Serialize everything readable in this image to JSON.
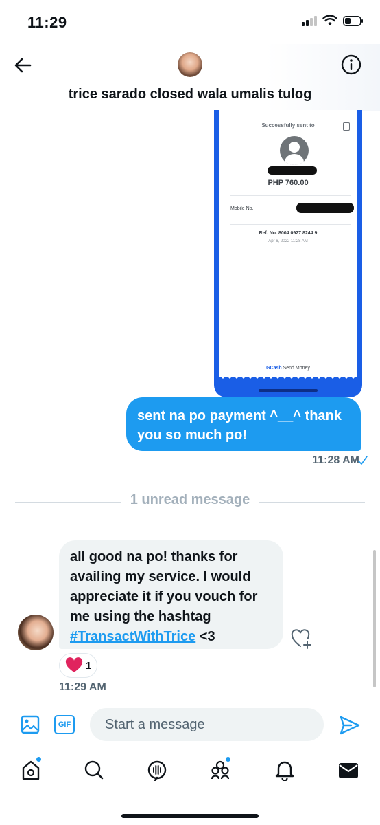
{
  "status_bar": {
    "time": "11:29"
  },
  "header": {
    "title": "trice sarado closed wala umalis tulog"
  },
  "receipt": {
    "heading": "Successfully sent to",
    "amount": "PHP 760.00",
    "mobile_label": "Mobile No.",
    "ref": "Ref. No. 8004 0927 8244 9",
    "date": "Apr 6, 2022 11:28 AM",
    "brand": "GCash",
    "brand_suffix": "Send Money"
  },
  "messages": [
    {
      "direction": "out",
      "text": "sent na po payment ^__^ thank you so much po!",
      "time": "11:28 AM"
    },
    {
      "direction": "in",
      "text_before": "all good na po! thanks for availing my service. I would appreciate it if you vouch for me using the hashtag",
      "hashtag": "#TransactWithTrice",
      "text_after": "<3",
      "reaction_count": "1",
      "time": "11:29 AM"
    }
  ],
  "divider": {
    "label": "1 unread message"
  },
  "composer": {
    "placeholder": "Start a message",
    "gif_label": "GIF"
  },
  "colors": {
    "accent": "#1d9bf0",
    "gcash_blue": "#1a5ee6"
  },
  "icons": [
    "back-arrow-icon",
    "info-icon",
    "image-icon",
    "gif-icon",
    "send-icon",
    "home-icon",
    "search-icon",
    "spaces-icon",
    "communities-icon",
    "bell-icon",
    "mail-icon",
    "heart-icon",
    "add-reaction-icon"
  ]
}
